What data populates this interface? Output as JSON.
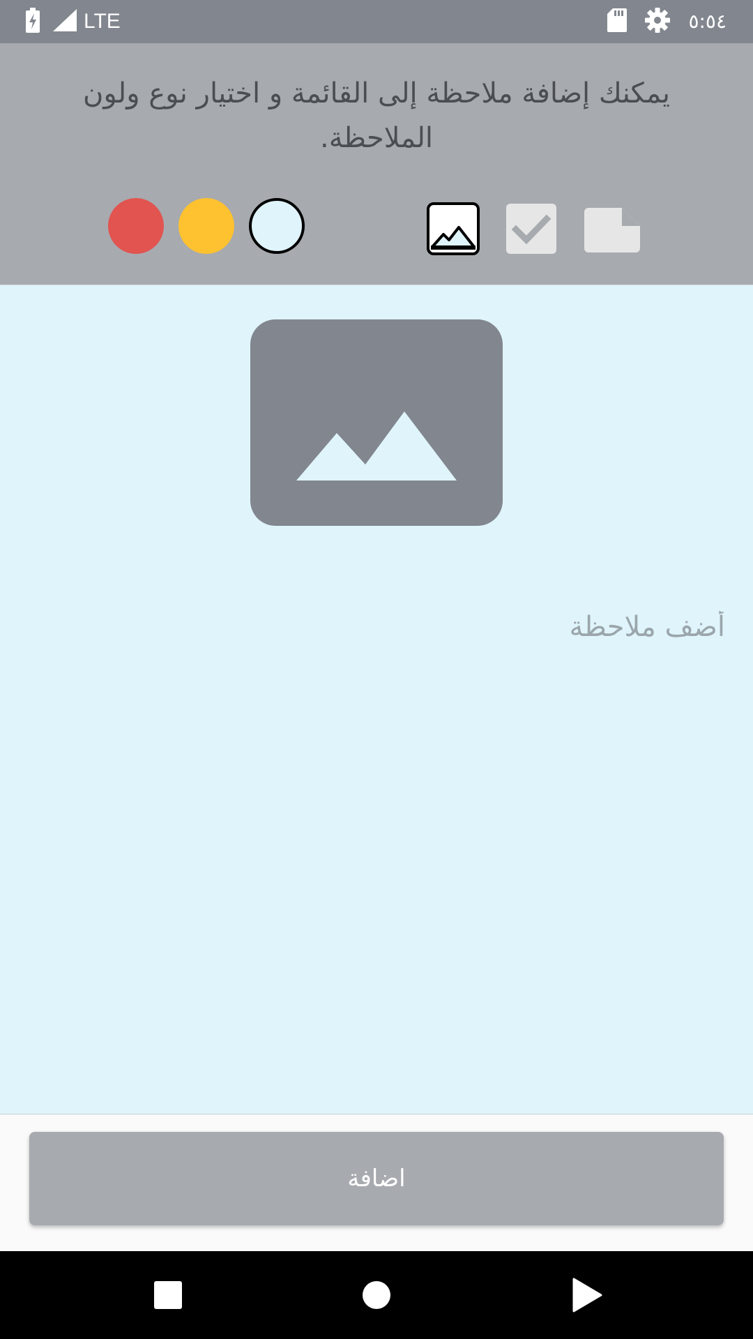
{
  "status_bar": {
    "network_label": "LTE",
    "time": "٥:٥٤",
    "icons": [
      "battery-charging-icon",
      "signal-icon",
      "sd-card-icon",
      "settings-gear-icon"
    ]
  },
  "header": {
    "instruction_text": "يمكنك إضافة ملاحظة إلى القائمة و اختيار نوع ولون الملاحظة."
  },
  "color_options": [
    {
      "name": "red",
      "color": "#e15450",
      "selected": false
    },
    {
      "name": "yellow",
      "color": "#fec130",
      "selected": false
    },
    {
      "name": "light-blue",
      "color": "#e0f4fb",
      "selected": true
    }
  ],
  "note_types": [
    {
      "name": "image",
      "icon": "image-icon",
      "selected": true
    },
    {
      "name": "checklist",
      "icon": "checkbox-icon",
      "selected": false
    },
    {
      "name": "text",
      "icon": "note-page-icon",
      "selected": false
    }
  ],
  "note": {
    "image_placeholder_icon": "mountain-image-icon",
    "input_value": "",
    "input_placeholder": "أضف ملاحظة",
    "background_color": "#e0f4fb"
  },
  "actions": {
    "add_label": "اضافة"
  },
  "nav_bar": {
    "icons": [
      "recents-square-icon",
      "home-circle-icon",
      "back-triangle-icon"
    ]
  },
  "colors": {
    "status_bar": "#82868e",
    "header_bg": "#a7aaaf",
    "button_bg": "#a7aaaf",
    "placeholder_gray": "#82868e"
  }
}
